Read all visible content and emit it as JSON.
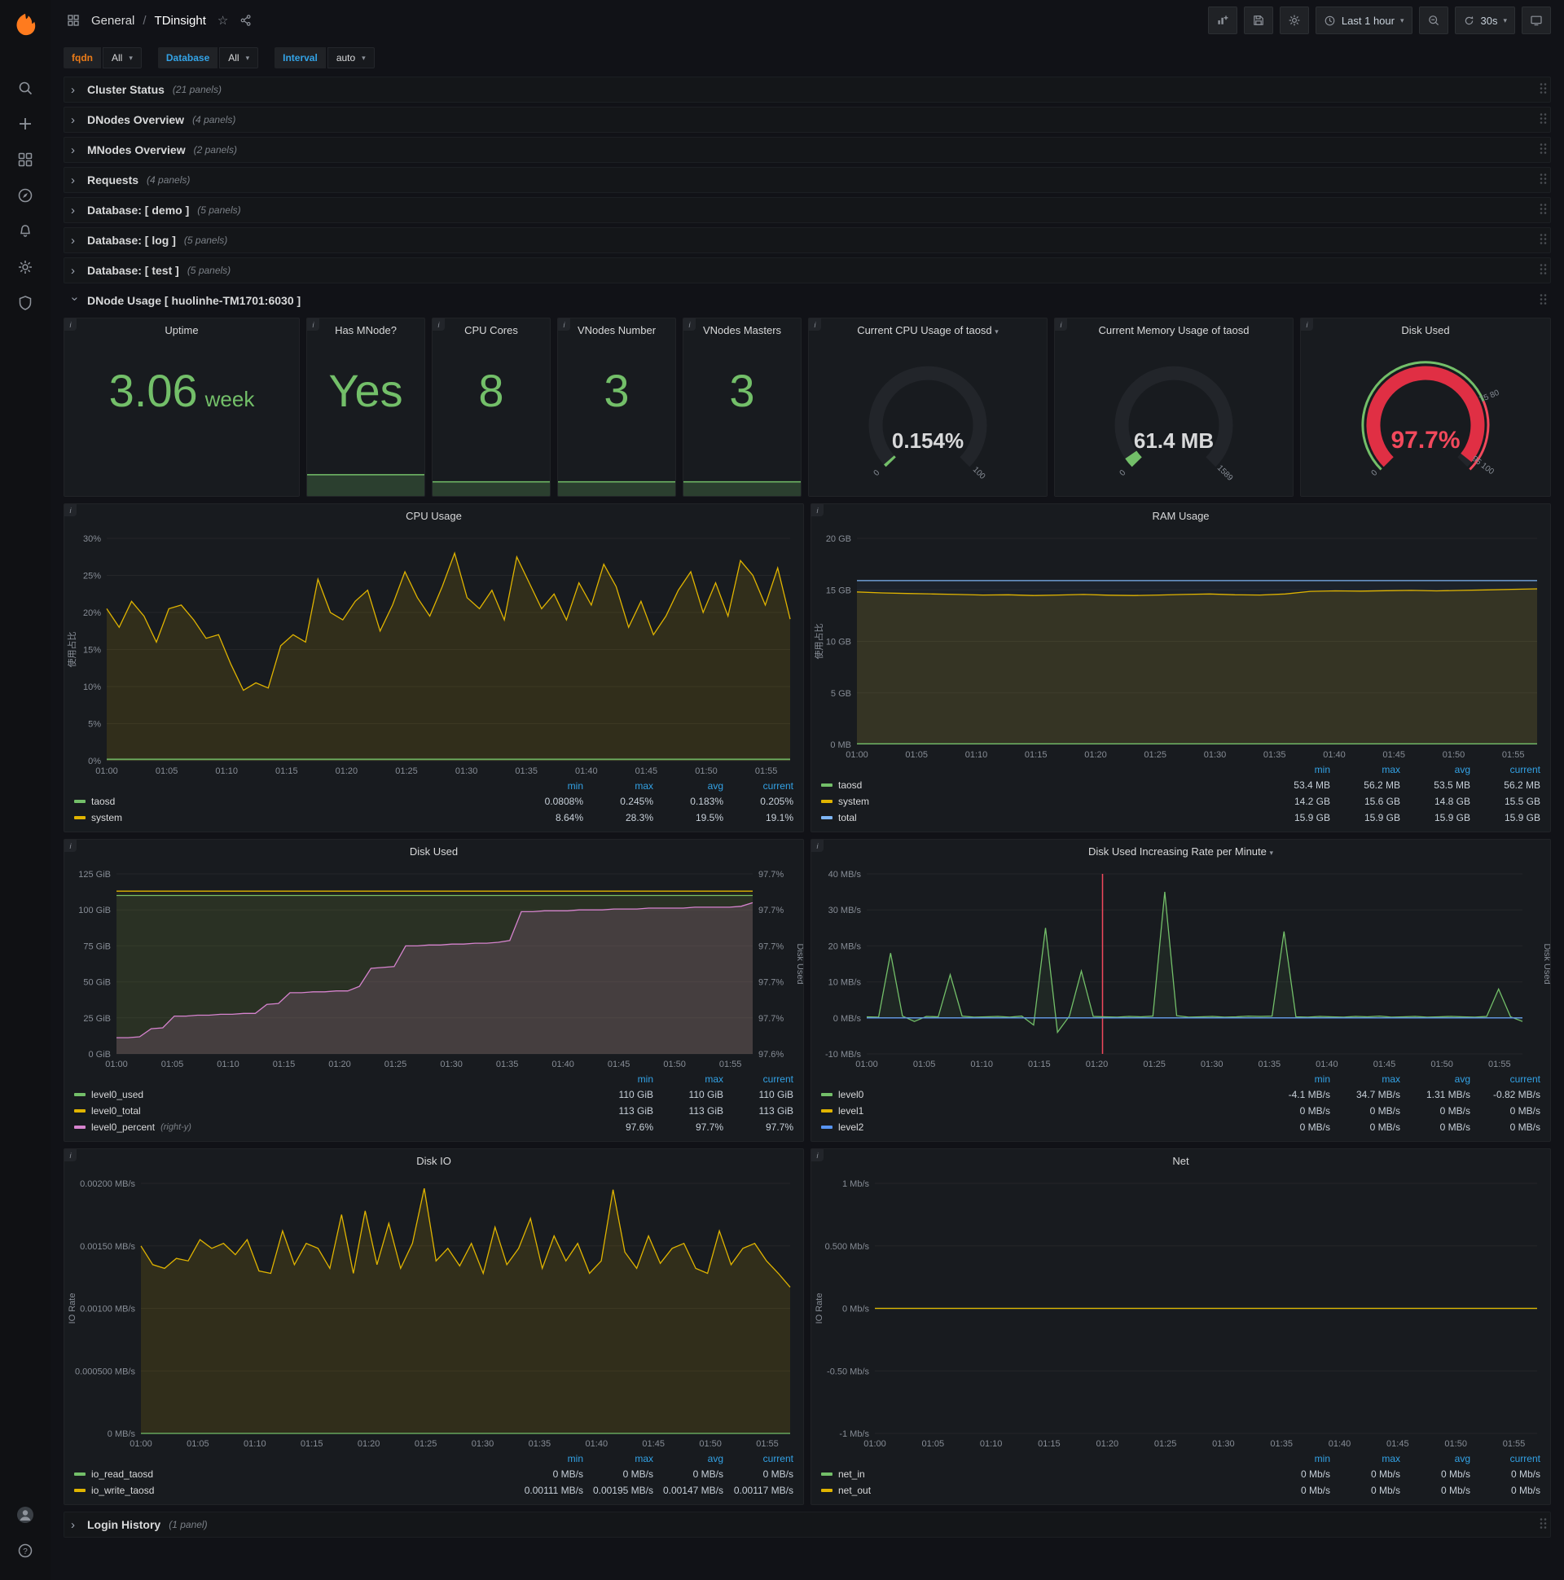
{
  "app": {
    "breadcrumb_section": "General",
    "breadcrumb_sep": "/",
    "breadcrumb_page": "TDinsight",
    "time_range": "Last 1 hour",
    "refresh_interval": "30s"
  },
  "variables": [
    {
      "label": "fqdn",
      "value": "All",
      "label_color": "#eb7b18"
    },
    {
      "label": "Database",
      "value": "All",
      "label_color": "#33a2e5"
    },
    {
      "label": "Interval",
      "value": "auto",
      "label_color": "#33a2e5"
    }
  ],
  "rows": [
    {
      "title": "Cluster Status",
      "count": "(21 panels)"
    },
    {
      "title": "DNodes Overview",
      "count": "(4 panels)"
    },
    {
      "title": "MNodes Overview",
      "count": "(2 panels)"
    },
    {
      "title": "Requests",
      "count": "(4 panels)"
    },
    {
      "title": "Database: [ demo ]",
      "count": "(5 panels)"
    },
    {
      "title": "Database: [ log ]",
      "count": "(5 panels)"
    },
    {
      "title": "Database: [ test ]",
      "count": "(5 panels)"
    }
  ],
  "expanded_row": {
    "title": "DNode Usage [ huolinhe-TM1701:6030 ]"
  },
  "footer_row": {
    "title": "Login History",
    "count": "(1 panel)"
  },
  "stats": [
    {
      "title": "Uptime",
      "value": "3.06",
      "unit": "week",
      "spark": false,
      "spark_frac": 0
    },
    {
      "title": "Has MNode?",
      "value": "Yes",
      "unit": "",
      "spark": true,
      "spark_frac": 0.45
    },
    {
      "title": "CPU Cores",
      "value": "8",
      "unit": "",
      "spark": true,
      "spark_frac": 0.3
    },
    {
      "title": "VNodes Number",
      "value": "3",
      "unit": "",
      "spark": true,
      "spark_frac": 0.3
    },
    {
      "title": "VNodes Masters",
      "value": "3",
      "unit": "",
      "spark": true,
      "spark_frac": 0.3
    }
  ],
  "gauges": [
    {
      "id": "cpu-gauge",
      "title": "Current CPU Usage of taosd",
      "has_caret": true,
      "value": "0.154%",
      "percent": 0.154,
      "color": "#73bf69",
      "value_color": "#d8d9da",
      "tick_labels": [
        {
          "pct": 0,
          "text": "0"
        },
        {
          "pct": 100,
          "text": "100"
        }
      ]
    },
    {
      "id": "mem-gauge",
      "title": "Current Memory Usage of taosd",
      "has_caret": false,
      "value": "61.4 MB",
      "percent": 3.86,
      "color": "#73bf69",
      "value_color": "#d8d9da",
      "tick_labels": [
        {
          "pct": 0,
          "text": "0"
        },
        {
          "pct": 100,
          "text": "1589"
        }
      ]
    },
    {
      "id": "disk-gauge",
      "title": "Disk Used",
      "has_caret": false,
      "value": "97.7%",
      "percent": 97.7,
      "color": "#e02f44",
      "value_color": "#f2495c",
      "threshold_arc": true,
      "tick_labels": [
        {
          "pct": 0,
          "text": "0"
        },
        {
          "pct": 75,
          "text": "75 80"
        },
        {
          "pct": 97,
          "text": "95 100"
        }
      ]
    }
  ],
  "chart_data": [
    {
      "id": "cpu-usage",
      "type": "line",
      "title": "CPU Usage",
      "has_caret": false,
      "ylabel": "使用占比",
      "ymin": 0,
      "ymax": 30,
      "ml": 52,
      "mr": 16,
      "xmax": 57,
      "yticks": [
        [
          0,
          "0%"
        ],
        [
          5,
          "5%"
        ],
        [
          10,
          "10%"
        ],
        [
          15,
          "15%"
        ],
        [
          20,
          "20%"
        ],
        [
          25,
          "25%"
        ],
        [
          30,
          "30%"
        ]
      ],
      "xticks": [
        "01:00",
        "01:05",
        "01:10",
        "01:15",
        "01:20",
        "01:25",
        "01:30",
        "01:35",
        "01:40",
        "01:45",
        "01:50",
        "01:55"
      ],
      "series": [
        {
          "name": "system",
          "color": "#e0b400",
          "fill": 0.13,
          "values": [
            20.5,
            18,
            21.5,
            19.5,
            16,
            20.5,
            21,
            19,
            16.5,
            17,
            13,
            9.5,
            10.5,
            9.8,
            15.5,
            17,
            16,
            24.5,
            20,
            19,
            21.5,
            23,
            17.5,
            21,
            25.5,
            22,
            19.5,
            23.5,
            28,
            22,
            20.5,
            23,
            19,
            27.5,
            24,
            20.5,
            22.5,
            19,
            24,
            21,
            26.5,
            23.5,
            18,
            21.5,
            17,
            19.5,
            23,
            25.5,
            20,
            24,
            19.5,
            27,
            25,
            21,
            26,
            19.1
          ]
        },
        {
          "name": "taosd",
          "color": "#73bf69",
          "fill": 0.18,
          "flat": 0.2,
          "n": 56
        }
      ],
      "legend": {
        "columns": [
          "min",
          "max",
          "avg",
          "current"
        ],
        "rows": [
          {
            "name": "taosd",
            "color": "#73bf69",
            "values": [
              "0.0808%",
              "0.245%",
              "0.183%",
              "0.205%"
            ]
          },
          {
            "name": "system",
            "color": "#e0b400",
            "values": [
              "8.64%",
              "28.3%",
              "19.5%",
              "19.1%"
            ]
          }
        ]
      }
    },
    {
      "id": "ram-usage",
      "type": "line",
      "title": "RAM Usage",
      "has_caret": false,
      "ylabel": "使用占比",
      "ymin": 0,
      "ymax": 20,
      "ml": 56,
      "mr": 16,
      "xmax": 57,
      "yticks": [
        [
          0,
          "0 MB"
        ],
        [
          5,
          "5 GB"
        ],
        [
          10,
          "10 GB"
        ],
        [
          15,
          "15 GB"
        ],
        [
          20,
          "20 GB"
        ]
      ],
      "xticks": [
        "01:00",
        "01:05",
        "01:10",
        "01:15",
        "01:20",
        "01:25",
        "01:30",
        "01:35",
        "01:40",
        "01:45",
        "01:50",
        "01:55"
      ],
      "series": [
        {
          "name": "total",
          "color": "#7eb6f6",
          "fill": 0.05,
          "flat": 15.9,
          "n": 56
        },
        {
          "name": "system",
          "color": "#e0b400",
          "fill": 0.13,
          "values": [
            14.8,
            14.7,
            14.65,
            14.6,
            14.55,
            14.5,
            14.52,
            14.45,
            14.5,
            14.55,
            14.48,
            14.45,
            14.5,
            14.55,
            14.6,
            14.52,
            14.5,
            14.6,
            14.85,
            14.9,
            14.88,
            14.92,
            14.95,
            14.9,
            14.95,
            15.0,
            15.05,
            15.1
          ]
        },
        {
          "name": "taosd",
          "color": "#73bf69",
          "fill": 0,
          "flat": 0.055,
          "n": 56
        }
      ],
      "legend": {
        "columns": [
          "min",
          "max",
          "avg",
          "current"
        ],
        "rows": [
          {
            "name": "taosd",
            "color": "#73bf69",
            "values": [
              "53.4 MB",
              "56.2 MB",
              "53.5 MB",
              "56.2 MB"
            ]
          },
          {
            "name": "system",
            "color": "#e0b400",
            "values": [
              "14.2 GB",
              "15.6 GB",
              "14.8 GB",
              "15.5 GB"
            ]
          },
          {
            "name": "total",
            "color": "#7eb6f6",
            "values": [
              "15.9 GB",
              "15.9 GB",
              "15.9 GB",
              "15.9 GB"
            ]
          }
        ]
      }
    },
    {
      "id": "disk-used",
      "type": "line",
      "title": "Disk Used",
      "has_caret": false,
      "ymin": 0,
      "ymax": 125,
      "ml": 64,
      "mr": 62,
      "xmax": 57,
      "rymin": 97.56,
      "rymax": 97.76,
      "rylabel": "Disk Used",
      "yticks": [
        [
          0,
          "0 GiB"
        ],
        [
          25,
          "25 GiB"
        ],
        [
          50,
          "50 GiB"
        ],
        [
          75,
          "75 GiB"
        ],
        [
          100,
          "100 GiB"
        ],
        [
          125,
          "125 GiB"
        ]
      ],
      "ryticks": [
        [
          97.56,
          "97.6%"
        ],
        [
          97.6,
          "97.7%"
        ],
        [
          97.64,
          "97.7%"
        ],
        [
          97.68,
          "97.7%"
        ],
        [
          97.72,
          "97.7%"
        ],
        [
          97.76,
          "97.7%"
        ]
      ],
      "xticks": [
        "01:00",
        "01:05",
        "01:10",
        "01:15",
        "01:20",
        "01:25",
        "01:30",
        "01:35",
        "01:40",
        "01:45",
        "01:50",
        "01:55"
      ],
      "series": [
        {
          "name": "level0_used",
          "color": "#73bf69",
          "fill": 0.1,
          "flat": 110,
          "n": 56
        },
        {
          "name": "level0_total",
          "color": "#e0b400",
          "fill": 0.05,
          "flat": 113,
          "n": 56
        },
        {
          "name": "level0_percent",
          "color": "#d683ce",
          "fill": 0.16,
          "axis": "right",
          "values": [
            97.578,
            97.578,
            97.579,
            97.588,
            97.589,
            97.602,
            97.602,
            97.603,
            97.603,
            97.604,
            97.604,
            97.605,
            97.605,
            97.615,
            97.616,
            97.628,
            97.628,
            97.629,
            97.629,
            97.63,
            97.63,
            97.635,
            97.655,
            97.656,
            97.657,
            97.68,
            97.68,
            97.681,
            97.681,
            97.682,
            97.682,
            97.683,
            97.683,
            97.684,
            97.686,
            97.718,
            97.718,
            97.719,
            97.719,
            97.719,
            97.72,
            97.72,
            97.72,
            97.721,
            97.721,
            97.721,
            97.722,
            97.722,
            97.722,
            97.722,
            97.723,
            97.723,
            97.723,
            97.723,
            97.724,
            97.728
          ]
        }
      ],
      "legend": {
        "columns": [
          "min",
          "max",
          "current"
        ],
        "rows": [
          {
            "name": "level0_used",
            "color": "#73bf69",
            "values": [
              "110 GiB",
              "110 GiB",
              "110 GiB"
            ]
          },
          {
            "name": "level0_total",
            "color": "#e0b400",
            "values": [
              "113 GiB",
              "113 GiB",
              "113 GiB"
            ]
          },
          {
            "name": "level0_percent",
            "suffix": "(right-y)",
            "color": "#d683ce",
            "values": [
              "97.6%",
              "97.7%",
              "97.7%"
            ]
          }
        ]
      }
    },
    {
      "id": "disk-rate",
      "type": "line",
      "title": "Disk Used Increasing Rate per Minute",
      "has_caret": true,
      "ymin": -10,
      "ymax": 40,
      "ml": 68,
      "mr": 34,
      "xmax": 57,
      "vline": 20.5,
      "rylabel": "Disk Used",
      "yticks": [
        [
          -10,
          "-10 MB/s"
        ],
        [
          0,
          "0 MB/s"
        ],
        [
          10,
          "10 MB/s"
        ],
        [
          20,
          "20 MB/s"
        ],
        [
          30,
          "30 MB/s"
        ],
        [
          40,
          "40 MB/s"
        ]
      ],
      "xticks": [
        "01:00",
        "01:05",
        "01:10",
        "01:15",
        "01:20",
        "01:25",
        "01:30",
        "01:35",
        "01:40",
        "01:45",
        "01:50",
        "01:55"
      ],
      "series": [
        {
          "name": "level0",
          "color": "#73bf69",
          "fill": 0.08,
          "values": [
            0.3,
            0.2,
            18,
            0.5,
            -1,
            0.4,
            0.3,
            12,
            0.5,
            0.2,
            0.3,
            0.4,
            0.2,
            0.5,
            -2,
            25,
            -4,
            0.5,
            13,
            0.4,
            0.3,
            0.2,
            0.4,
            0.3,
            0.5,
            35,
            0.6,
            0.2,
            0.3,
            0.4,
            0.2,
            0.3,
            0.5,
            0.4,
            0.5,
            24,
            0.3,
            0.2,
            0.4,
            0.3,
            0.2,
            0.4,
            0.3,
            0.5,
            0.2,
            0.3,
            0.4,
            0.2,
            0.3,
            0.4,
            0.3,
            0.2,
            0.4,
            8,
            0.3,
            -1
          ]
        },
        {
          "name": "level1",
          "color": "#e0b400",
          "fill": 0,
          "flat": 0,
          "n": 56
        },
        {
          "name": "level2",
          "color": "#5794f2",
          "fill": 0,
          "flat": 0,
          "n": 56
        }
      ],
      "legend": {
        "columns": [
          "min",
          "max",
          "avg",
          "current"
        ],
        "rows": [
          {
            "name": "level0",
            "color": "#73bf69",
            "values": [
              "-4.1 MB/s",
              "34.7 MB/s",
              "1.31 MB/s",
              "-0.82 MB/s"
            ]
          },
          {
            "name": "level1",
            "color": "#e0b400",
            "values": [
              "0 MB/s",
              "0 MB/s",
              "0 MB/s",
              "0 MB/s"
            ]
          },
          {
            "name": "level2",
            "color": "#5794f2",
            "values": [
              "0 MB/s",
              "0 MB/s",
              "0 MB/s",
              "0 MB/s"
            ]
          }
        ]
      }
    },
    {
      "id": "disk-io",
      "type": "line",
      "title": "Disk IO",
      "has_caret": false,
      "ylabel": "IO Rate",
      "ymin": 0,
      "ymax": 0.002,
      "ml": 94,
      "mr": 16,
      "xmax": 57,
      "yticks": [
        [
          0,
          "0 MB/s"
        ],
        [
          0.0005,
          "0.000500 MB/s"
        ],
        [
          0.001,
          "0.00100 MB/s"
        ],
        [
          0.0015,
          "0.00150 MB/s"
        ],
        [
          0.002,
          "0.00200 MB/s"
        ]
      ],
      "xticks": [
        "01:00",
        "01:05",
        "01:10",
        "01:15",
        "01:20",
        "01:25",
        "01:30",
        "01:35",
        "01:40",
        "01:45",
        "01:50",
        "01:55"
      ],
      "series": [
        {
          "name": "io_write_taosd",
          "color": "#e0b400",
          "fill": 0.13,
          "values": [
            0.0015,
            0.00135,
            0.00132,
            0.0014,
            0.00138,
            0.00155,
            0.00148,
            0.00152,
            0.00143,
            0.00155,
            0.0013,
            0.00128,
            0.00162,
            0.00135,
            0.00152,
            0.00148,
            0.00132,
            0.00175,
            0.00128,
            0.00178,
            0.00135,
            0.00168,
            0.00132,
            0.00152,
            0.00196,
            0.00138,
            0.00148,
            0.00134,
            0.00152,
            0.00128,
            0.00165,
            0.00135,
            0.00148,
            0.00172,
            0.00132,
            0.00158,
            0.00138,
            0.00152,
            0.00128,
            0.00138,
            0.00195,
            0.00145,
            0.00132,
            0.00158,
            0.00136,
            0.00148,
            0.00152,
            0.00132,
            0.00128,
            0.00162,
            0.00135,
            0.00148,
            0.00152,
            0.00138,
            0.00128,
            0.00117
          ]
        },
        {
          "name": "io_read_taosd",
          "color": "#73bf69",
          "fill": 0,
          "flat": 0,
          "n": 56
        }
      ],
      "legend": {
        "columns": [
          "min",
          "max",
          "avg",
          "current"
        ],
        "rows": [
          {
            "name": "io_read_taosd",
            "color": "#73bf69",
            "values": [
              "0 MB/s",
              "0 MB/s",
              "0 MB/s",
              "0 MB/s"
            ]
          },
          {
            "name": "io_write_taosd",
            "color": "#e0b400",
            "values": [
              "0.00111 MB/s",
              "0.00195 MB/s",
              "0.00147 MB/s",
              "0.00117 MB/s"
            ]
          }
        ]
      }
    },
    {
      "id": "net",
      "type": "line",
      "title": "Net",
      "has_caret": false,
      "ylabel": "IO Rate",
      "ymin": -1,
      "ymax": 1,
      "ml": 78,
      "mr": 16,
      "xmax": 57,
      "yticks": [
        [
          -1,
          "-1 Mb/s"
        ],
        [
          -0.5,
          "-0.50 Mb/s"
        ],
        [
          0,
          "0 Mb/s"
        ],
        [
          0.5,
          "0.500 Mb/s"
        ],
        [
          1,
          "1 Mb/s"
        ]
      ],
      "xticks": [
        "01:00",
        "01:05",
        "01:10",
        "01:15",
        "01:20",
        "01:25",
        "01:30",
        "01:35",
        "01:40",
        "01:45",
        "01:50",
        "01:55"
      ],
      "series": [
        {
          "name": "net_in",
          "color": "#73bf69",
          "fill": 0,
          "flat": 0,
          "n": 56
        },
        {
          "name": "net_out",
          "color": "#e0b400",
          "fill": 0,
          "flat": 0,
          "n": 56
        }
      ],
      "legend": {
        "columns": [
          "min",
          "max",
          "avg",
          "current"
        ],
        "rows": [
          {
            "name": "net_in",
            "color": "#73bf69",
            "values": [
              "0 Mb/s",
              "0 Mb/s",
              "0 Mb/s",
              "0 Mb/s"
            ]
          },
          {
            "name": "net_out",
            "color": "#e0b400",
            "values": [
              "0 Mb/s",
              "0 Mb/s",
              "0 Mb/s",
              "0 Mb/s"
            ]
          }
        ]
      }
    }
  ]
}
